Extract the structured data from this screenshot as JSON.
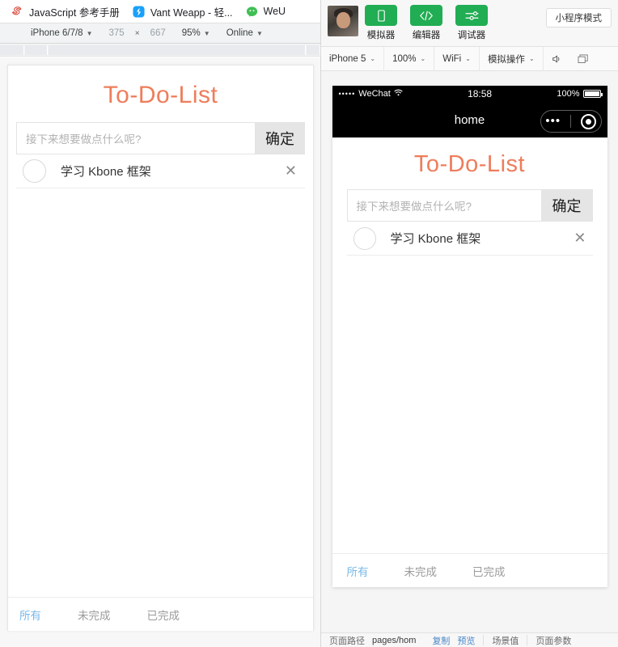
{
  "browser": {
    "tabs": [
      {
        "label": "JavaScript 参考手册",
        "icon": "sencha-logo-icon"
      },
      {
        "label": "Vant Weapp - 轻...",
        "icon": "vant-logo-icon"
      },
      {
        "label": "WeU",
        "icon": "wechat-logo-icon"
      }
    ],
    "device_toolbar": {
      "device": "iPhone 6/7/8",
      "width": "375",
      "times": "×",
      "height": "667",
      "zoom": "95%",
      "throttling": "Online"
    }
  },
  "todo_app": {
    "title": "To-Do-List",
    "input_placeholder": "接下来想要做点什么呢?",
    "input_value": "",
    "confirm_label": "确定",
    "items": [
      {
        "text": "学习 Kbone 框架",
        "done": false,
        "delete_label": "✕"
      }
    ],
    "filters": [
      {
        "label": "所有",
        "active": true
      },
      {
        "label": "未完成",
        "active": false
      },
      {
        "label": "已完成",
        "active": false
      }
    ]
  },
  "devtools": {
    "toolbar_buttons": [
      {
        "label": "模拟器",
        "icon": "phone-icon"
      },
      {
        "label": "编辑器",
        "icon": "code-icon"
      },
      {
        "label": "调试器",
        "icon": "sliders-icon"
      }
    ],
    "mode_button": "小程序模式",
    "subbar": {
      "device": "iPhone 5",
      "scale": "100%",
      "network": "WiFi",
      "simulate": "模拟操作",
      "volume_icon": "speaker-icon",
      "window_icon": "window-icon"
    },
    "simulator": {
      "statusbar": {
        "signal_dots": "•••••",
        "carrier": "WeChat",
        "wifi_icon": "wifi-icon",
        "time": "18:58",
        "battery_percent": "100%"
      },
      "nav_title": "home",
      "capsule": {
        "menu_icon": "more-dots-icon",
        "target_icon": "target-icon"
      }
    },
    "bottombar": {
      "page_path_label": "页面路径",
      "page_path_value": "pages/hom",
      "copy_label": "复制",
      "preview_label": "预览",
      "scene_label": "场景值",
      "params_label": "页面参数"
    }
  },
  "colors": {
    "brand_orange": "#ee7d5b",
    "wechat_green": "#21ad53",
    "active_tab_blue": "#79b8e8"
  }
}
